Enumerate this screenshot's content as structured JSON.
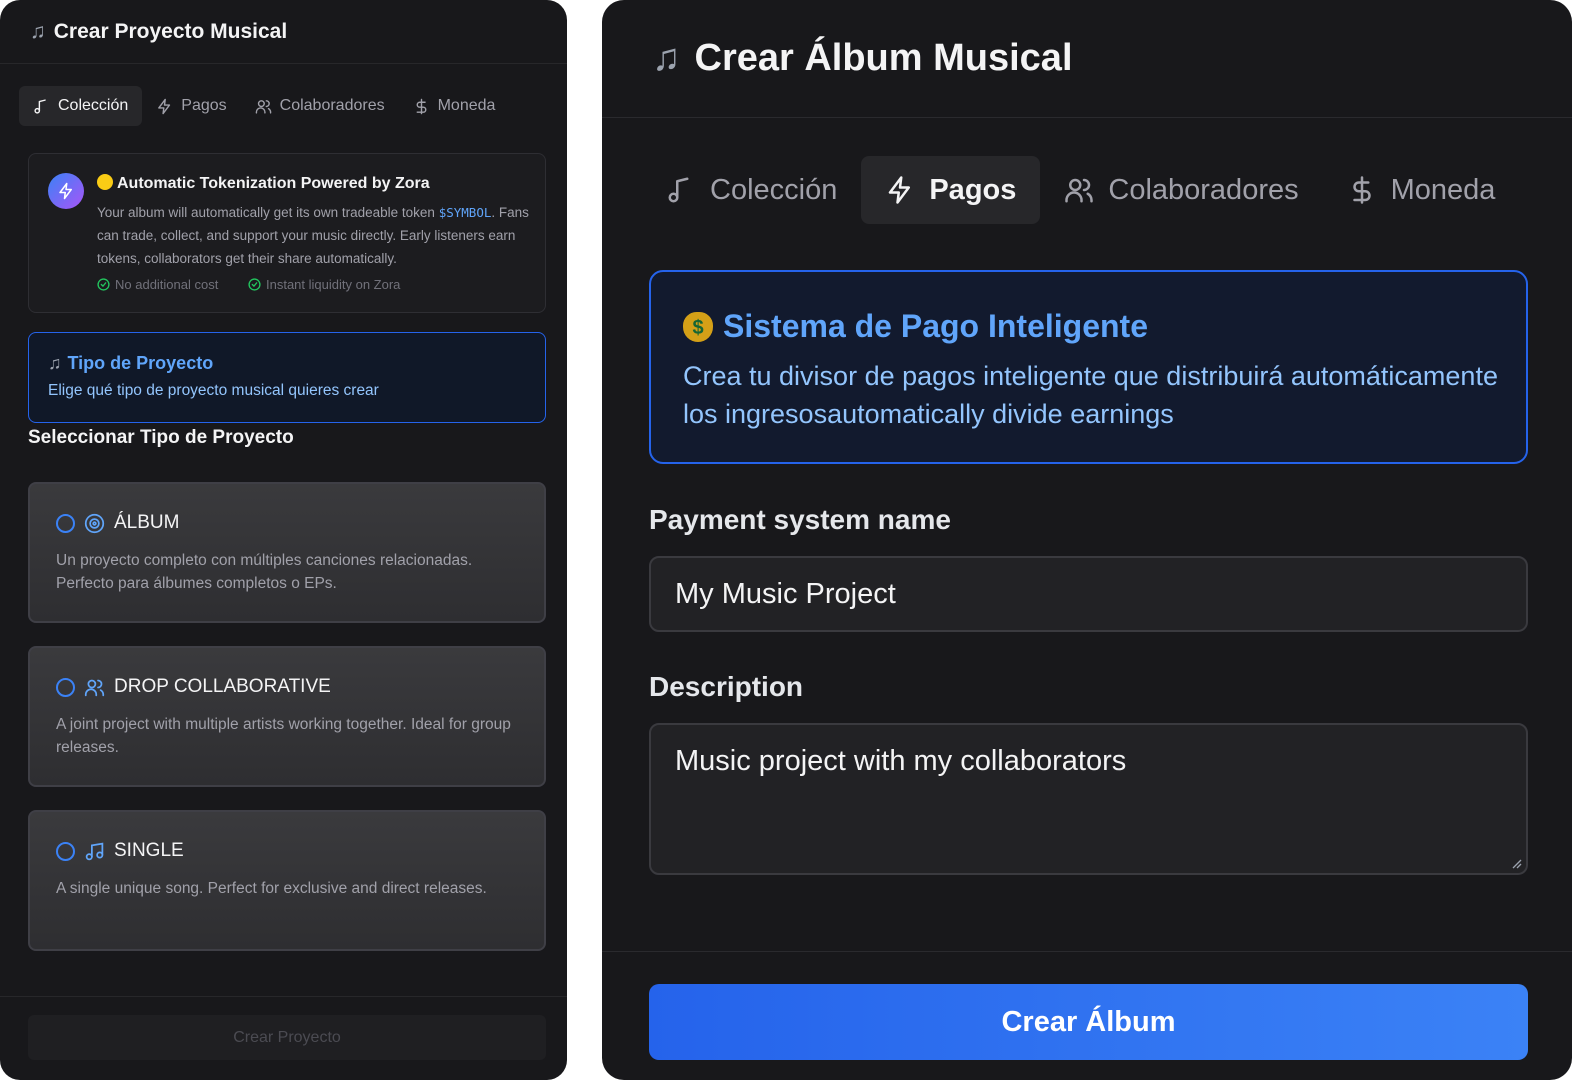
{
  "left": {
    "title": "Crear Proyecto Musical",
    "tabs": [
      {
        "label": "Colección",
        "icon": "music-note-icon",
        "active": true
      },
      {
        "label": "Pagos",
        "icon": "lightning-icon",
        "active": false
      },
      {
        "label": "Colaboradores",
        "icon": "users-icon",
        "active": false
      },
      {
        "label": "Moneda",
        "icon": "dollar-icon",
        "active": false
      }
    ],
    "zora": {
      "title": "Automatic Tokenization Powered by Zora",
      "text_pre": "Your album will automatically get its own tradeable token ",
      "token": "$SYMBOL",
      "text_post": ". Fans can trade, collect, and support your music directly. Early listeners earn tokens, collaborators get their share automatically.",
      "feature_1": "No additional cost",
      "feature_2": "Instant liquidity on Zora"
    },
    "project_type": {
      "title": "Tipo de Proyecto",
      "description": "Elige qué tipo de proyecto musical quieres crear"
    },
    "select_heading": "Seleccionar Tipo de Proyecto",
    "options": [
      {
        "title": "ÁLBUM",
        "icon": "disc-icon",
        "description": "Un proyecto completo con múltiples canciones relacionadas. Perfecto para álbumes completos o EPs."
      },
      {
        "title": "DROP COLLABORATIVE",
        "icon": "users-icon",
        "description": "A joint project with multiple artists working together. Ideal for group releases."
      },
      {
        "title": "SINGLE",
        "icon": "music-notes-icon",
        "description": "A single unique song. Perfect for exclusive and direct releases."
      }
    ],
    "create_button": "Crear Proyecto"
  },
  "right": {
    "title": "Crear Álbum Musical",
    "tabs": [
      {
        "label": "Colección",
        "icon": "music-note-icon",
        "active": false
      },
      {
        "label": "Pagos",
        "icon": "lightning-icon",
        "active": true
      },
      {
        "label": "Colaboradores",
        "icon": "users-icon",
        "active": false
      },
      {
        "label": "Moneda",
        "icon": "dollar-icon",
        "active": false
      }
    ],
    "smart_payment": {
      "title": "Sistema de Pago Inteligente",
      "description": "Crea tu divisor de pagos inteligente que distribuirá automáticamente los ingresosautomatically divide earnings"
    },
    "payment_name_label": "Payment system name",
    "payment_name_value": "My Music Project",
    "description_label": "Description",
    "description_value": "Music project with my collaborators",
    "create_button": "Crear Álbum"
  },
  "colors": {
    "panel_bg": "#18181b",
    "accent_blue": "#2563eb",
    "link_blue": "#60a5fa",
    "success_green": "#22c55e"
  }
}
